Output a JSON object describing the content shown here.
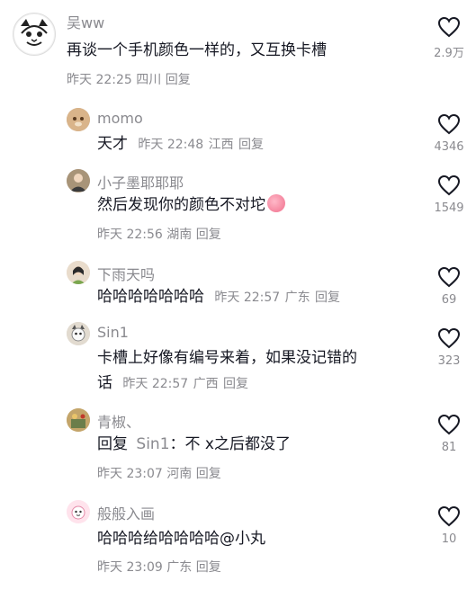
{
  "comments": [
    {
      "username": "吴ww",
      "text_line1": "再谈一个手机颜色一样的，又互换卡槽",
      "time": "昨天 22:25",
      "location": "四川",
      "reply": "回复",
      "likes": "2.9万"
    },
    {
      "username": "momo",
      "text": "天才",
      "time": "昨天 22:48",
      "location": "江西",
      "reply": "回复",
      "likes": "4346"
    },
    {
      "username": "小子墨耶耶耶",
      "text": "然后发现你的颜色不对坨",
      "time": "昨天 22:56",
      "location": "湖南",
      "reply": "回复",
      "likes": "1549"
    },
    {
      "username": "下雨天吗",
      "text": "哈哈哈哈哈哈哈",
      "time": "昨天 22:57",
      "location": "广东",
      "reply": "回复",
      "likes": "69"
    },
    {
      "username": "Sin1",
      "text_line1": "卡槽上好像有编号来着，如果没记错的",
      "text_line2": "话",
      "time": "昨天 22:57",
      "location": "广西",
      "reply": "回复",
      "likes": "323"
    },
    {
      "username": "青椒、",
      "reply_prefix": "回复",
      "reply_target": "Sin1",
      "text": "：不 x之后都没了",
      "time": "昨天 23:07",
      "location": "河南",
      "reply": "回复",
      "likes": "81"
    },
    {
      "username": "般般入画",
      "text": "哈哈哈给哈哈哈哈@小丸",
      "time": "昨天 23:09",
      "location": "广东",
      "reply": "回复",
      "likes": "10"
    }
  ],
  "colors": {
    "text": "#161823",
    "secondary": "#8a8a8f",
    "background": "#ffffff"
  }
}
